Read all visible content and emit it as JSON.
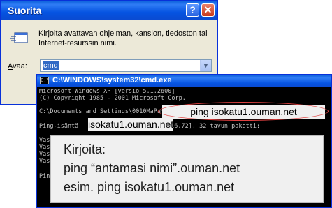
{
  "run_dialog": {
    "title": "Suorita",
    "help_glyph": "?",
    "close_glyph": "✕",
    "description": "Kirjoita avattavan ohjelman, kansion, tiedoston tai Internet-resurssin nimi.",
    "open_label_accel": "A",
    "open_label_rest": "vaa:",
    "open_value": "cmd",
    "dropdown_glyph": "▼",
    "icon": "run-icon"
  },
  "cmd_window": {
    "title": "C:\\WINDOWS\\system32\\cmd.exe",
    "icon_glyph": "C:\\",
    "lines": {
      "l1": "Microsoft Windows XP [versio 5.1.2600]",
      "l2": "(C) Copyright 1985 - 2001 Microsoft Corp.",
      "l3": "C:\\Documents and Settings\\0010MaPa>",
      "l4_prefix": "Ping-isäntä",
      "l4_suffix": "[192.107.216.72], 32 tavun paketti:",
      "l5": "Vas",
      "l6": "Vas",
      "l7": "Vas",
      "l8": "Vas",
      "l9": "Pin"
    },
    "ping_command": "ping isokatu1.ouman.net",
    "reply_host": "isokatu1.ouman.net"
  },
  "instruction": {
    "line1": "Kirjoita:",
    "line2": "ping “antamasi nimi”.ouman.net",
    "line3": "esim. ping isokatu1.ouman.net"
  },
  "colors": {
    "xp_blue": "#0553e1",
    "highlight_red": "#e04040",
    "selection_blue": "#316ac5"
  }
}
